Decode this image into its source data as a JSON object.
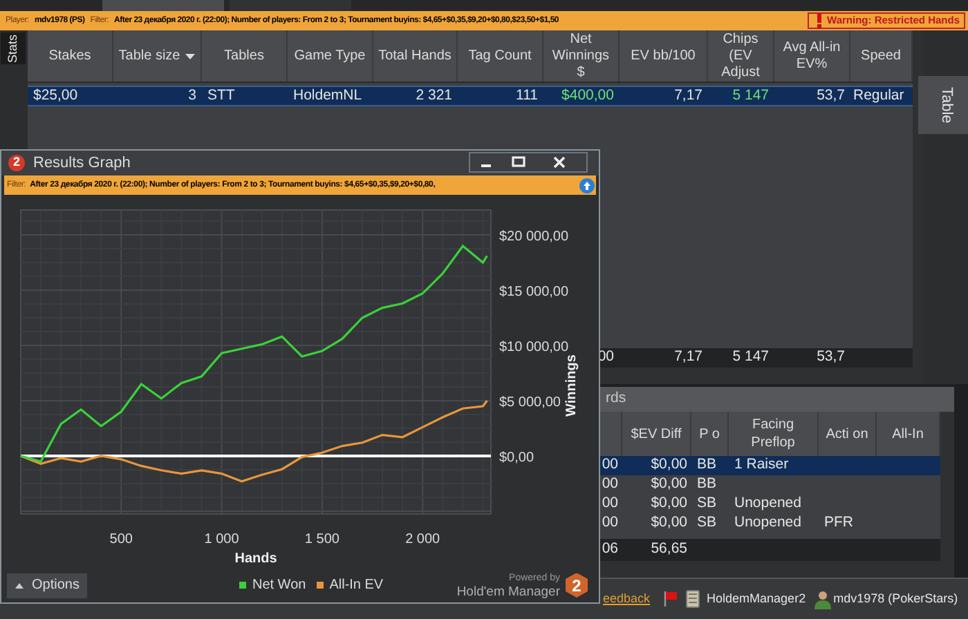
{
  "top_bar": {
    "player_label": "Player:",
    "player": "mdv1978 (PS)",
    "filter_label": "Filter:",
    "filter": "After 23 декабря 2020 г. (22:00); Number of players: From 2 to 3; Tournament buyins: $4,65+$0,35,$9,20+$0,80,$23,50+$1,50",
    "warning": "Warning: Restricted Hands"
  },
  "left_tab": {
    "label": "Stats"
  },
  "right_tab": {
    "label": "Table"
  },
  "stats_table": {
    "columns": [
      {
        "label": "Stakes",
        "kind": "text",
        "sorted": false
      },
      {
        "label": "Table size",
        "kind": "number",
        "sorted": true
      },
      {
        "label": "Tables",
        "kind": "text",
        "sorted": false
      },
      {
        "label": "Game Type",
        "kind": "text",
        "sorted": false
      },
      {
        "label": "Total Hands",
        "kind": "number",
        "sorted": false
      },
      {
        "label": "Tag Count",
        "kind": "number",
        "sorted": false
      },
      {
        "label": "Net Winnings $",
        "kind": "result",
        "sorted": false,
        "total": "00"
      },
      {
        "label": "EV bb/100",
        "kind": "number",
        "sorted": false,
        "total": "7,17"
      },
      {
        "label": "Chips (EV Adjust",
        "kind": "result",
        "sorted": false,
        "total": "5 147"
      },
      {
        "label": "Avg All-in EV%",
        "kind": "number",
        "sorted": false,
        "total": "53,7"
      },
      {
        "label": "Speed",
        "kind": "text",
        "sorted": false
      }
    ],
    "rows": [
      {
        "selected": true,
        "cells": [
          "$25,00",
          "3",
          "STT",
          "HoldemNL",
          "2 321",
          "111",
          "$400,00",
          "7,17",
          "5 147",
          "53,7",
          "Regular"
        ]
      }
    ]
  },
  "hands_panel": {
    "title": "rds",
    "columns": [
      {
        "kind": "number"
      },
      {
        "label": "$EV Diff",
        "kind": "number"
      },
      {
        "label": "P o",
        "kind": "text"
      },
      {
        "label": "Facing Preflop",
        "kind": "text"
      },
      {
        "label": "Acti on",
        "kind": "text"
      },
      {
        "label": "All-In"
      }
    ],
    "totals": [
      "06",
      "56,65"
    ],
    "rows": [
      {
        "selected": true,
        "cells": [
          "00",
          "$0,00",
          "BB",
          "1 Raiser"
        ]
      },
      {
        "selected": false,
        "cells": [
          "00",
          "$0,00",
          "BB"
        ]
      },
      {
        "selected": false,
        "cells": [
          "00",
          "$0,00",
          "SB",
          "Unopened"
        ]
      },
      {
        "selected": false,
        "cells": [
          "00",
          "$0,00",
          "SB",
          "Unopened",
          "PFR"
        ]
      }
    ]
  },
  "status_bar": {
    "link": "eedback",
    "app": "HoldemManager2",
    "user": "mdv1978 (PokerStars)"
  },
  "graph_window": {
    "badge": "2",
    "title": "Results Graph",
    "filter_label": "Filter:",
    "filter": "After 23 декабря 2020 г. (22:00); Number of players: From 2 to 3; Tournament buyins: $4,65+$0,35,$9,20+$0,80,",
    "chart_data": {
      "type": "line",
      "grid": true,
      "xlabel": "Hands",
      "ylabel": "Winnings",
      "x": [
        0,
        100,
        200,
        300,
        400,
        500,
        600,
        700,
        800,
        900,
        1000,
        1100,
        1200,
        1300,
        1400,
        1500,
        1600,
        1700,
        1800,
        1900,
        2000,
        2100,
        2200,
        2300,
        2321
      ],
      "series": [
        {
          "name": "Net Won",
          "color": "#3ad13a",
          "values": [
            0,
            -500,
            2900,
            4200,
            2700,
            4000,
            6500,
            5200,
            6600,
            7200,
            9300,
            9700,
            10100,
            10800,
            9000,
            9500,
            10600,
            12500,
            13400,
            13800,
            14700,
            16500,
            19000,
            17500,
            18100
          ]
        },
        {
          "name": "All-In EV",
          "color": "#e8953c",
          "values": [
            0,
            -700,
            -200,
            -500,
            0,
            -300,
            -900,
            -1300,
            -1600,
            -1300,
            -1600,
            -2300,
            -1700,
            -1200,
            -100,
            300,
            900,
            1200,
            1900,
            1700,
            2600,
            3500,
            4300,
            4500,
            5000
          ]
        }
      ],
      "xlim": [
        0,
        2340
      ],
      "ylim": [
        -5250,
        22250
      ],
      "xticks": [
        {
          "value": 500,
          "label": "500"
        },
        {
          "value": 1000,
          "label": "1 000"
        },
        {
          "value": 1500,
          "label": "1 500"
        },
        {
          "value": 2000,
          "label": "2 000"
        }
      ],
      "yticks": [
        {
          "value": 0,
          "label": "$0,00"
        },
        {
          "value": 5000,
          "label": "$5 000,00"
        },
        {
          "value": 10000,
          "label": "$10 000,00"
        },
        {
          "value": 15000,
          "label": "$15 000,00"
        },
        {
          "value": 20000,
          "label": "$20 000,00"
        }
      ]
    },
    "options_button": "Options",
    "powered_by": "Powered by",
    "brand": "Hold'em Manager",
    "logo_mark": "2"
  }
}
